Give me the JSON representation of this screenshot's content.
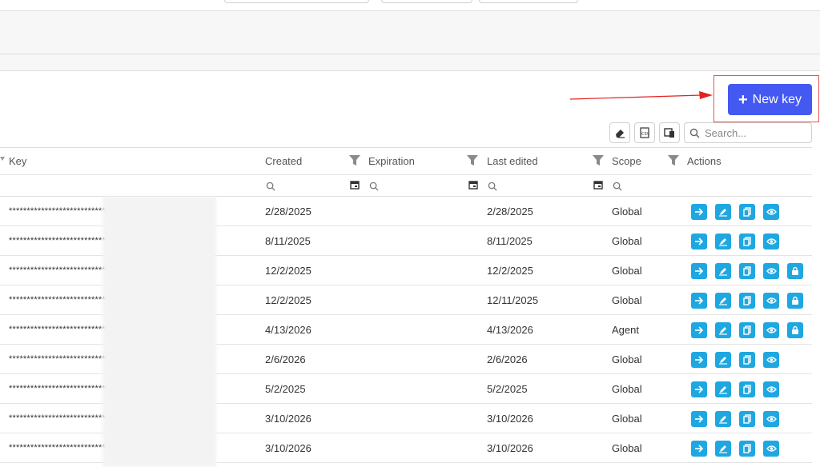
{
  "toolbar": {
    "new_key_label": "New key",
    "search_placeholder": "Search..."
  },
  "table": {
    "columns": [
      "Key",
      "Created",
      "Expiration",
      "Last edited",
      "Scope",
      "Actions"
    ],
    "rows": [
      {
        "key": "****************************",
        "created": "2/28/2025",
        "expiration": "",
        "last_edited": "2/28/2025",
        "scope": "Global",
        "locked": false
      },
      {
        "key": "****************************",
        "created": "8/11/2025",
        "expiration": "",
        "last_edited": "8/11/2025",
        "scope": "Global",
        "locked": false
      },
      {
        "key": "****************************",
        "created": "12/2/2025",
        "expiration": "",
        "last_edited": "12/2/2025",
        "scope": "Global",
        "locked": true
      },
      {
        "key": "****************************",
        "created": "12/2/2025",
        "expiration": "",
        "last_edited": "12/11/2025",
        "scope": "Global",
        "locked": true
      },
      {
        "key": "****************************",
        "created": "4/13/2026",
        "expiration": "",
        "last_edited": "4/13/2026",
        "scope": "Agent",
        "locked": true
      },
      {
        "key": "****************************",
        "created": "2/6/2026",
        "expiration": "",
        "last_edited": "2/6/2026",
        "scope": "Global",
        "locked": false
      },
      {
        "key": "****************************",
        "created": "5/2/2025",
        "expiration": "",
        "last_edited": "5/2/2025",
        "scope": "Global",
        "locked": false
      },
      {
        "key": "****************************",
        "created": "3/10/2026",
        "expiration": "",
        "last_edited": "3/10/2026",
        "scope": "Global",
        "locked": false
      },
      {
        "key": "****************************",
        "created": "3/10/2026",
        "expiration": "",
        "last_edited": "3/10/2026",
        "scope": "Global",
        "locked": false
      }
    ]
  },
  "colors": {
    "primary_button": "#4458f2",
    "action_button": "#1ea7e1",
    "callout_border": "#e25555"
  }
}
